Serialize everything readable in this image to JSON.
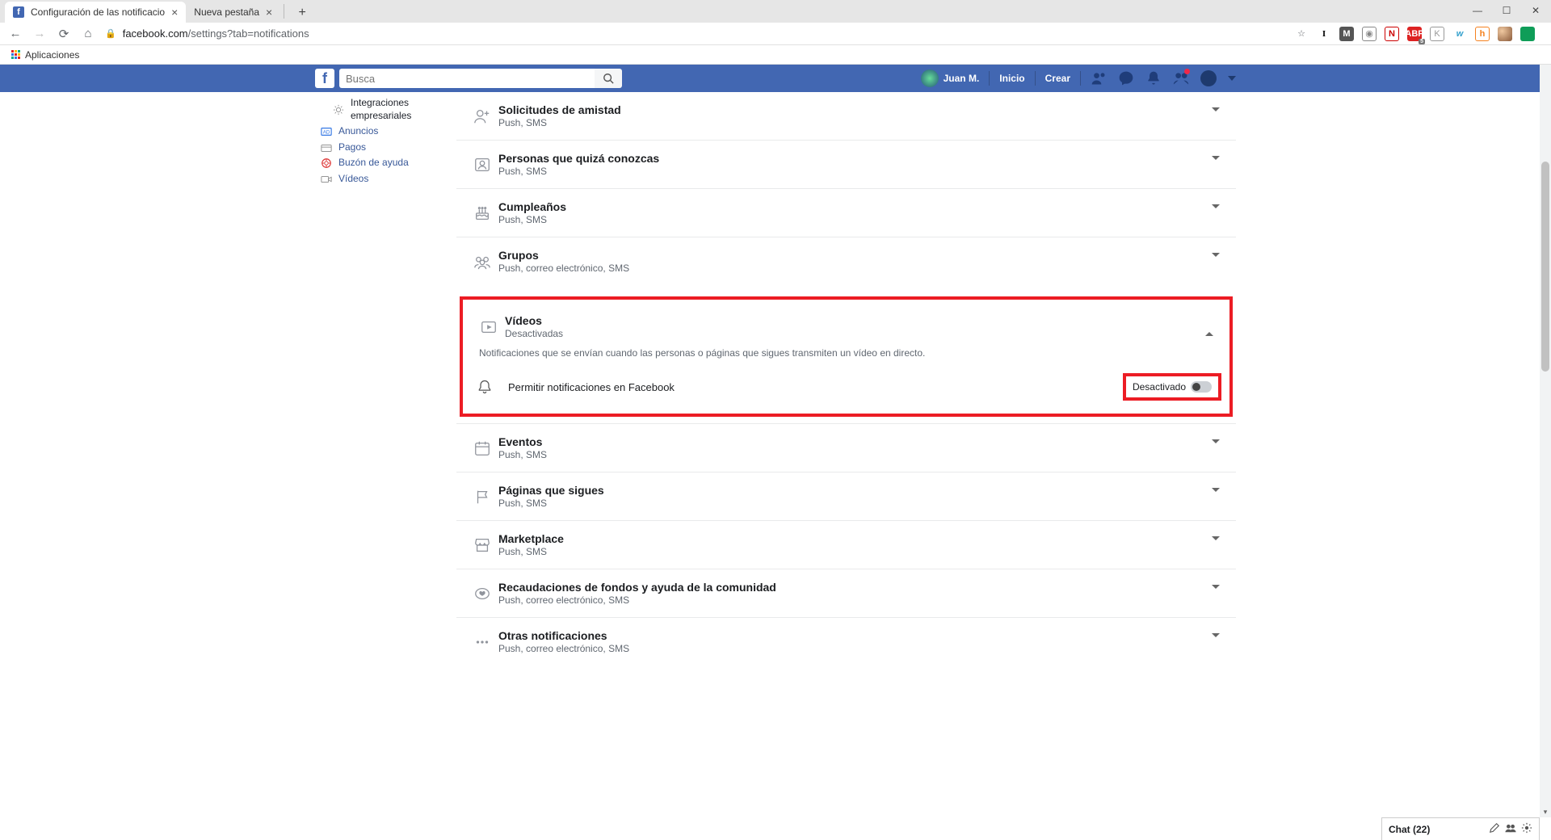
{
  "browser": {
    "tabs": [
      {
        "title": "Configuración de las notificacio",
        "active": true
      },
      {
        "title": "Nueva pestaña",
        "active": false
      }
    ],
    "url_domain": "facebook.com",
    "url_path": "/settings?tab=notifications",
    "bookmarks_label": "Aplicaciones"
  },
  "fb": {
    "search_placeholder": "Busca",
    "user_name": "Juan M.",
    "nav_home": "Inicio",
    "nav_create": "Crear"
  },
  "sidebar": {
    "items": [
      {
        "label": "Integraciones empresariales",
        "icon": "gear",
        "sub": true
      },
      {
        "label": "Anuncios",
        "icon": "ad"
      },
      {
        "label": "Pagos",
        "icon": "card"
      },
      {
        "label": "Buzón de ayuda",
        "icon": "lifebuoy"
      },
      {
        "label": "Vídeos",
        "icon": "video"
      }
    ]
  },
  "sections_before": [
    {
      "title": "Solicitudes de amistad",
      "sub": "Push, SMS",
      "icon": "friend-add"
    },
    {
      "title": "Personas que quizá conozcas",
      "sub": "Push, SMS",
      "icon": "person-card"
    },
    {
      "title": "Cumpleaños",
      "sub": "Push, SMS",
      "icon": "cake"
    },
    {
      "title": "Grupos",
      "sub": "Push, correo electrónico, SMS",
      "icon": "groups"
    }
  ],
  "videos": {
    "title": "Vídeos",
    "sub": "Desactivadas",
    "desc": "Notificaciones que se envían cuando las personas o páginas que sigues transmiten un vídeo en directo.",
    "permit_label": "Permitir notificaciones en Facebook",
    "toggle_state": "Desactivado"
  },
  "sections_after": [
    {
      "title": "Eventos",
      "sub": "Push, SMS",
      "icon": "calendar"
    },
    {
      "title": "Páginas que sigues",
      "sub": "Push, SMS",
      "icon": "flag"
    },
    {
      "title": "Marketplace",
      "sub": "Push, SMS",
      "icon": "store"
    },
    {
      "title": "Recaudaciones de fondos y ayuda de la comunidad",
      "sub": "Push, correo electrónico, SMS",
      "icon": "heart"
    },
    {
      "title": "Otras notificaciones",
      "sub": "Push, correo electrónico, SMS",
      "icon": "dots"
    }
  ],
  "chat": {
    "label": "Chat (22)"
  }
}
